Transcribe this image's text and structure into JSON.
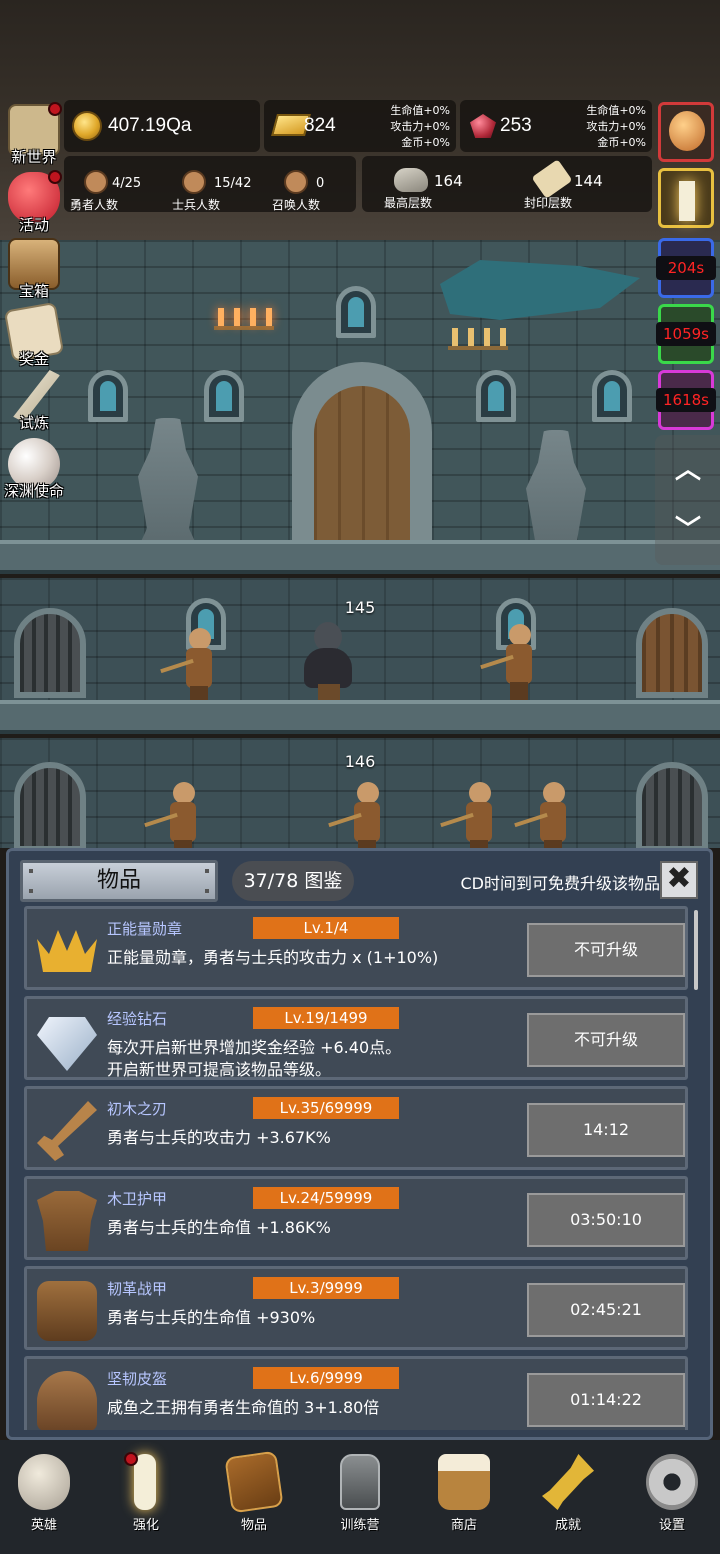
{
  "resources": {
    "coins": "407.19Qa",
    "gold_bars": "824",
    "gold_bars_bonus": [
      "生命值+0%",
      "攻击力+0%",
      "金币+0%"
    ],
    "ruby": "253",
    "ruby_bonus": [
      "生命值+0%",
      "攻击力+0%",
      "金币+0%"
    ]
  },
  "stats": {
    "heroes_value": "4/25",
    "heroes_label": "勇者人数",
    "soldiers_value": "15/42",
    "soldiers_label": "士兵人数",
    "summons_value": "0",
    "summons_label": "召唤人数",
    "max_floor_value": "164",
    "max_floor_label": "最高层数",
    "sealed_floor_value": "144",
    "sealed_floor_label": "封印层数"
  },
  "left_menu": [
    {
      "label": "新世界",
      "icon": "map-icon",
      "badge": true
    },
    {
      "label": "活动",
      "icon": "heart-icon",
      "badge": true
    },
    {
      "label": "宝箱",
      "icon": "chest-icon",
      "badge": false
    },
    {
      "label": "奖金",
      "icon": "envelope-icon",
      "badge": false
    },
    {
      "label": "试炼",
      "icon": "feather-icon",
      "badge": false
    },
    {
      "label": "深渊使命",
      "icon": "pearl-icon",
      "badge": false
    }
  ],
  "right_column": {
    "timers": [
      "204s",
      "1059s",
      "1618s"
    ]
  },
  "floors": [
    "145",
    "146"
  ],
  "inventory": {
    "tab_label": "物品",
    "codex_label": "37/78 图鉴",
    "hint": "CD时间到可免费升级该物品",
    "close_label": "✖",
    "items": [
      {
        "name": "正能量勋章",
        "level": "Lv.1/4",
        "desc": "正能量勋章，勇者与士兵的攻击力 x (1+10%)",
        "action": "不可升级",
        "icon": "crown-icon"
      },
      {
        "name": "经验钻石",
        "level": "Lv.19/1499",
        "desc": "每次开启新世界增加奖金经验 +6.40点。\n开启新世界可提高该物品等级。",
        "action": "不可升级",
        "icon": "diamond-icon"
      },
      {
        "name": "初木之刃",
        "level": "Lv.35/69999",
        "desc": "勇者与士兵的攻击力 +3.67K%",
        "action": "14:12",
        "icon": "wooden-sword-icon"
      },
      {
        "name": "木卫护甲",
        "level": "Lv.24/59999",
        "desc": "勇者与士兵的生命值 +1.86K%",
        "action": "03:50:10",
        "icon": "wooden-armor-icon"
      },
      {
        "name": "韧革战甲",
        "level": "Lv.3/9999",
        "desc": "勇者与士兵的生命值 +930%",
        "action": "02:45:21",
        "icon": "leather-armor-icon"
      },
      {
        "name": "坚韧皮盔",
        "level": "Lv.6/9999",
        "desc": "咸鱼之王拥有勇者生命值的 3+1.80倍",
        "action": "01:14:22",
        "icon": "leather-helmet-icon"
      }
    ]
  },
  "bottom_nav": [
    {
      "label": "英雄",
      "icon": "skull-icon",
      "badge": false
    },
    {
      "label": "强化",
      "icon": "candle-icon",
      "badge": true
    },
    {
      "label": "物品",
      "icon": "book-icon",
      "badge": false
    },
    {
      "label": "训练营",
      "icon": "lantern-icon",
      "badge": false
    },
    {
      "label": "商店",
      "icon": "beer-mug-icon",
      "badge": false
    },
    {
      "label": "成就",
      "icon": "key-icon",
      "badge": false
    },
    {
      "label": "设置",
      "icon": "gear-icon",
      "badge": false
    }
  ],
  "colors": {
    "level_badge": "#e07218",
    "item_name": "#b7c6ff",
    "timer_text": "#ff2424",
    "badge_red": "#c0141e"
  }
}
